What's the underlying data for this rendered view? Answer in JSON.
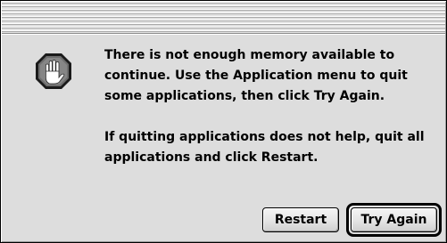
{
  "dialog": {
    "icon": "stop-hand-icon",
    "message": [
      "There is not enough memory available to continue. Use the Application menu to quit some applications, then click Try Again.",
      "If quitting applications does not help, quit all applications and click Restart."
    ],
    "buttons": {
      "restart": "Restart",
      "try_again": "Try Again"
    }
  }
}
